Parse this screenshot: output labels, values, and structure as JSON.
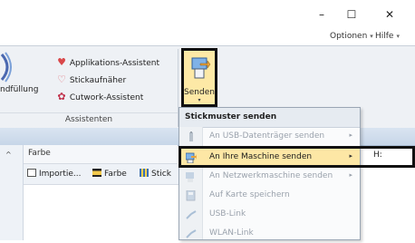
{
  "window": {
    "minimize": "–",
    "maximize": "☐",
    "close": "✕"
  },
  "tabs": {
    "optionen": "Optionen",
    "hilfe": "Hilfe",
    "chevron": "▾"
  },
  "ribbon": {
    "applikations": "Applikations-Assistent",
    "stickaufnaeher": "Stickaufnäher",
    "cutwork": "Cutwork-Assistent",
    "fuellung": "ndfüllung",
    "group_label": "Assistenten",
    "senden": "Senden",
    "senden_arrow": "▾"
  },
  "menu": {
    "title": "Stickmuster senden",
    "items": [
      {
        "label": "An USB-Datenträger senden",
        "arrow": "▸"
      },
      {
        "label": "An Ihre Maschine senden",
        "arrow": "▸"
      },
      {
        "label": "An Netzwerkmaschine senden",
        "arrow": "▸"
      },
      {
        "label": "Auf Karte speichern",
        "arrow": ""
      },
      {
        "label": "USB-Link",
        "arrow": ""
      },
      {
        "label": "WLAN-Link",
        "arrow": ""
      }
    ]
  },
  "lower": {
    "farbe_header": "Farbe",
    "scroll_up": "^",
    "toolbar": {
      "importie": "Importie...",
      "farbe": "Farbe",
      "stick": "Stick"
    },
    "h_label": "H:"
  },
  "colors": {
    "accent_highlight": "#fde7a5",
    "ribbon_bg": "#eef1f5",
    "heart": "#d9484a"
  }
}
